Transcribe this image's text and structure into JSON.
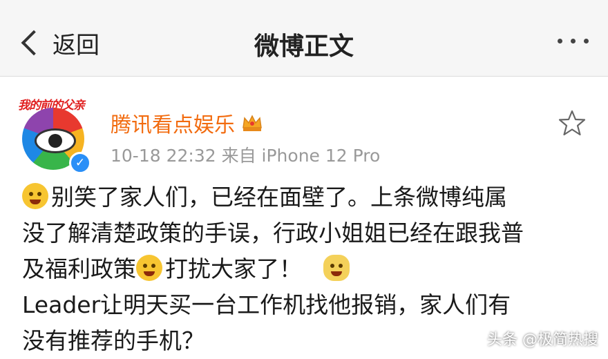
{
  "nav": {
    "back_label": "返回",
    "title": "微博正文"
  },
  "post": {
    "avatar_banner": "我的前的父亲",
    "author": "腾讯看点娱乐",
    "meta": "10-18 22:32  来自 iPhone 12 Pro",
    "lines": [
      "别笑了家人们，已经在面壁了。上条微博纯属",
      "没了解清楚政策的手误，行政小姐姐已经在跟我普",
      "及福利政策",
      "打扰大家了！",
      "Leader让明天买一台工作机找他报销，家人们有",
      "没有推荐的手机？"
    ]
  },
  "watermark": "头条 @极简热搜",
  "colors": {
    "author": "#f26b0f",
    "verified": "#2a8ff7",
    "nav_bg": "#f6f6f6"
  },
  "icons": [
    "back-chevron-icon",
    "more-icon",
    "crown-icon",
    "star-icon",
    "verified-icon",
    "crying-emoji-icon",
    "laughing-emoji-icon",
    "cat-emoji-icon"
  ]
}
